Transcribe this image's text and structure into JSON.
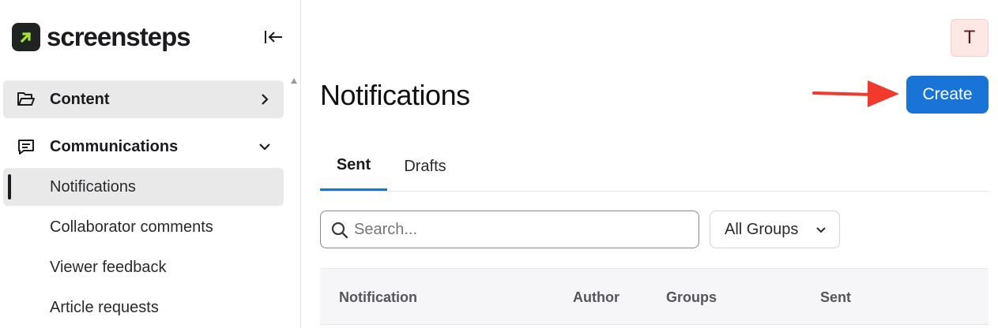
{
  "brand": {
    "name": "screensteps"
  },
  "sidebar": {
    "nav": [
      {
        "label": "Content",
        "icon": "folder-open-icon"
      },
      {
        "label": "Communications",
        "icon": "message-square-icon"
      }
    ],
    "communications_items": [
      {
        "label": "Notifications",
        "active": true
      },
      {
        "label": "Collaborator comments"
      },
      {
        "label": "Viewer feedback"
      },
      {
        "label": "Article requests"
      }
    ]
  },
  "user": {
    "initial": "T"
  },
  "page": {
    "title": "Notifications",
    "create_label": "Create",
    "tabs": [
      {
        "label": "Sent",
        "active": true
      },
      {
        "label": "Drafts"
      }
    ],
    "search": {
      "placeholder": "Search...",
      "value": ""
    },
    "groups_filter": {
      "selected": "All Groups"
    },
    "table": {
      "columns": [
        "Notification",
        "Author",
        "Groups",
        "Sent"
      ]
    }
  },
  "colors": {
    "accent": "#1a73d6",
    "logo_bg": "#1f2421",
    "logo_arrow": "#a6e22e",
    "annotation_arrow": "#f03a2e",
    "active_bg": "#e9e9ea",
    "avatar_bg": "#fde8e6"
  }
}
